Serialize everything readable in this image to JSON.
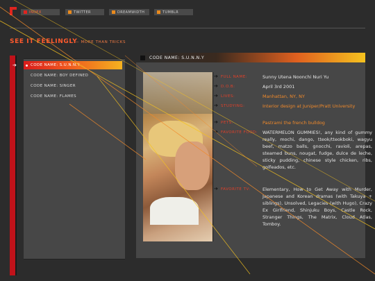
{
  "nav": {
    "tabs": [
      {
        "label": "INDEX",
        "active": true
      },
      {
        "label": "TWITTER",
        "active": false
      },
      {
        "label": "DREAMWIDTH",
        "active": false
      },
      {
        "label": "TUMBLR",
        "active": false
      }
    ]
  },
  "header": {
    "title": "SEE IT FEELINGLY",
    "subtitle": "— MORE THAN TRICKS"
  },
  "sidebar": {
    "items": [
      {
        "label": "CODE NAME: S.U.N.N.Y",
        "active": true
      },
      {
        "label": "CODE NAME: BOY DEFINED",
        "active": false
      },
      {
        "label": "CODE NAME: SINGER",
        "active": false
      },
      {
        "label": "CODE NAME: FLAMES",
        "active": false
      }
    ]
  },
  "profile": {
    "header": "CODE NAME: S.U.N.N.Y",
    "fields": [
      {
        "label": "FULL NAME:",
        "value": "Sunny Utena Noonchi Nuri Yu",
        "accent": false
      },
      {
        "label": "D.O.B:",
        "value": "April 3rd 2001",
        "accent": false
      },
      {
        "label": "LIVES:",
        "value": "Manhattan, NY, NY",
        "accent": true
      },
      {
        "label": "STUDYING:",
        "value": "Interior design at Juniper/Pratt University",
        "accent": true
      },
      {
        "label": "PETS:",
        "value": "Pastrami the french bulldog",
        "accent": true
      },
      {
        "label": "FAVORITE FOOD:",
        "value": "WATERMELON GUMMIES!, any kind of gummy really, mochi, dango, tteok/tteokboki, wagyu beef, matzo balls, gnocchi, ravioli, arepas, steamed buns, nougat, fudge, dulce de leche, sticky pudding, chinese style chicken, ribs, golfeados, etc.",
        "accent": false
      },
      {
        "label": "FAVORITE TV:",
        "value": "Elementary, How to Get Away with Murder, Japanese and Korean dramas (with Takuya + siblings), Unsolved, Legacies (with Hugo), Crazy Ex Girlfriend, Shinjuku Boys, Castle Rock, Stranger Things, The Matrix, Cloud Atlas, Tomboy.",
        "accent": false
      }
    ]
  },
  "colors": {
    "accent_red": "#e0241f",
    "accent_orange": "#f28a2a",
    "accent_yellow": "#f5c21f",
    "panel": "#474747",
    "background": "#2c2c2c"
  }
}
